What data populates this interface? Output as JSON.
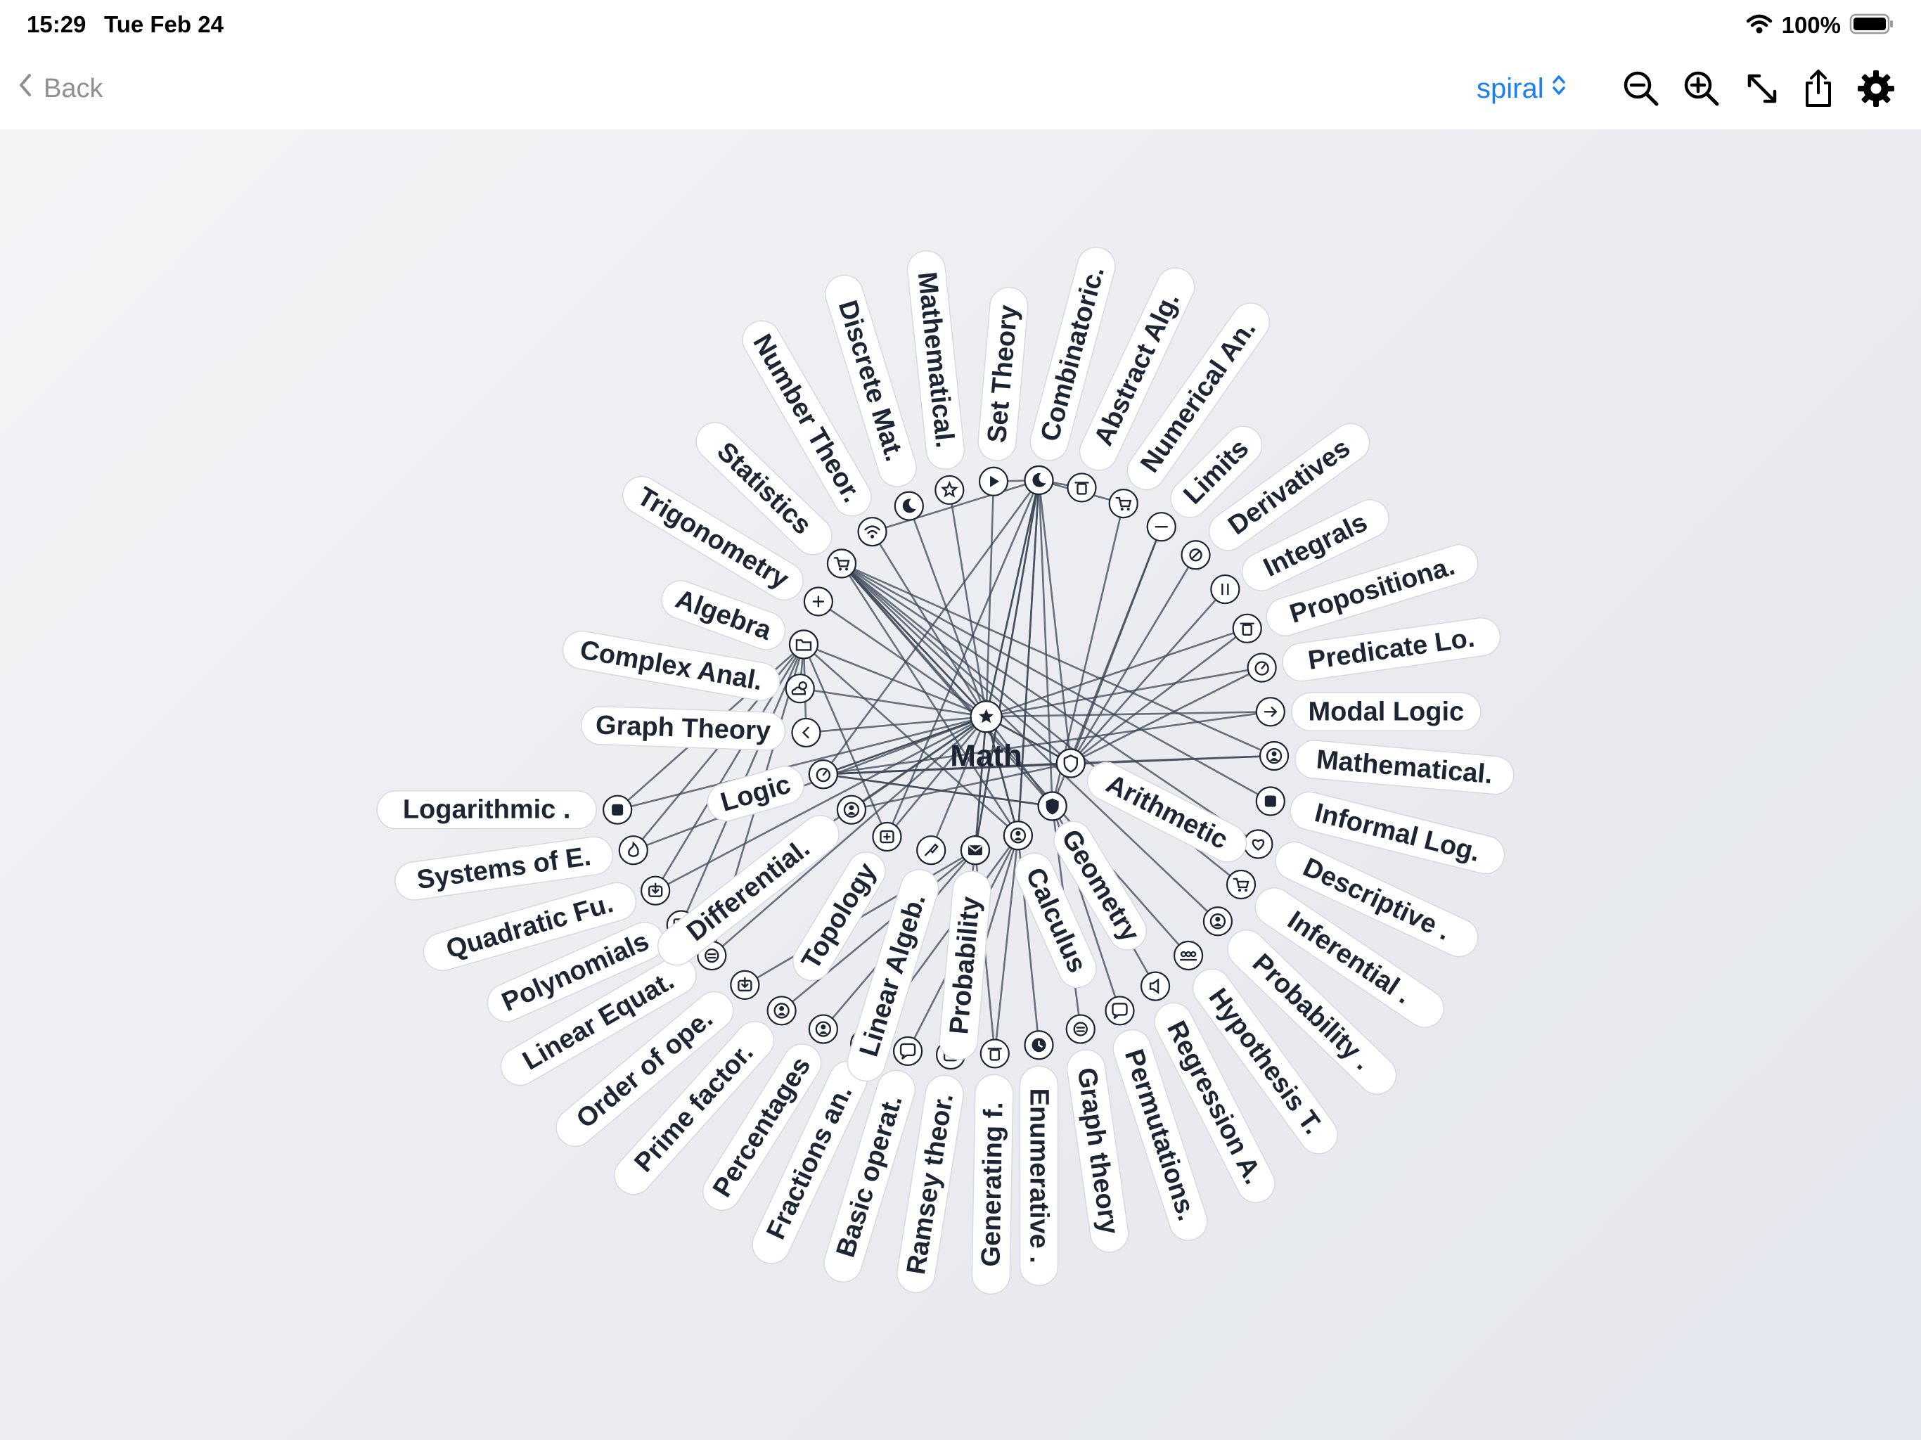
{
  "status_bar": {
    "time": "15:29",
    "date": "Tue Feb 24",
    "battery": "100%"
  },
  "toolbar": {
    "back_label": "Back",
    "layout_mode": "spiral",
    "icons": [
      "zoom-out-icon",
      "zoom-in-icon",
      "expand-icon",
      "share-icon",
      "gear-icon"
    ],
    "accent_color": "#1a7ff0"
  },
  "graph": {
    "root": {
      "label": "Math",
      "icon": "star"
    },
    "hubs": {
      "star": {
        "icon": "star"
      },
      "shield": {
        "icon": "shield-outline"
      },
      "shield2": {
        "icon": "shield-filled"
      },
      "moon": {
        "icon": "moon"
      },
      "cart": {
        "icon": "cart"
      },
      "timer": {
        "icon": "timer"
      },
      "person": {
        "icon": "person"
      },
      "mail": {
        "icon": "mail"
      },
      "folder": {
        "icon": "folder"
      }
    },
    "nodes": [
      {
        "label": "Number Theor.",
        "icon": "wifi"
      },
      {
        "label": "Discrete Mat.",
        "icon": "moon"
      },
      {
        "label": "Mathematical.",
        "icon": "star-outline"
      },
      {
        "label": "Set Theory",
        "icon": "play"
      },
      {
        "label": "Combinatoric.",
        "icon": "moon"
      },
      {
        "label": "Abstract Alg.",
        "icon": "trash"
      },
      {
        "label": "Numerical An.",
        "icon": "cart"
      },
      {
        "label": "Limits",
        "icon": "minus"
      },
      {
        "label": "Derivatives",
        "icon": "slash"
      },
      {
        "label": "Integrals",
        "icon": "pause"
      },
      {
        "label": "Propositiona.",
        "icon": "trash"
      },
      {
        "label": "Predicate Lo.",
        "icon": "timer"
      },
      {
        "label": "Modal Logic",
        "icon": "arrow-right"
      },
      {
        "label": "Mathematical.",
        "icon": "person"
      },
      {
        "label": "Informal Log.",
        "icon": "stop"
      },
      {
        "label": "Descriptive .",
        "icon": "heart"
      },
      {
        "label": "Inferential .",
        "icon": "cart"
      },
      {
        "label": "Probability .",
        "icon": "person"
      },
      {
        "label": "Hypothesis T.",
        "icon": "group"
      },
      {
        "label": "Regression A.",
        "icon": "speaker"
      },
      {
        "label": "Permutations.",
        "icon": "bubble"
      },
      {
        "label": "Graph theory",
        "icon": "disc"
      },
      {
        "label": "Enumerative .",
        "icon": "clock"
      },
      {
        "label": "Generating f.",
        "icon": "trash"
      },
      {
        "label": "Ramsey theor.",
        "icon": "minus-box"
      },
      {
        "label": "Basic operat.",
        "icon": "bubble"
      },
      {
        "label": "Fractions an.",
        "icon": "cloud"
      },
      {
        "label": "Percentages",
        "icon": "person"
      },
      {
        "label": "Prime factor.",
        "icon": "person"
      },
      {
        "label": "Order of ope.",
        "icon": "download"
      },
      {
        "label": "Linear Equat.",
        "icon": "disc"
      },
      {
        "label": "Polynomials",
        "icon": "monitor"
      },
      {
        "label": "Quadratic Fu.",
        "icon": "download"
      },
      {
        "label": "Systems of E.",
        "icon": "flame"
      },
      {
        "label": "Logarithmic .",
        "icon": "stop"
      },
      {
        "label": "Graph Theory",
        "icon": "chevron-left"
      },
      {
        "label": "Complex Anal.",
        "icon": "cloud-sun"
      },
      {
        "label": "Algebra",
        "icon": "folder"
      },
      {
        "label": "Trigonometry",
        "icon": "plus"
      },
      {
        "label": "Statistics",
        "icon": "cart"
      },
      {
        "label": "Logic",
        "icon": "timer"
      },
      {
        "label": "Differential.",
        "icon": "person"
      },
      {
        "label": "Topology",
        "icon": "plus-box"
      },
      {
        "label": "Linear Algeb.",
        "icon": "pin"
      },
      {
        "label": "Probability",
        "icon": "mail"
      },
      {
        "label": "Calculus",
        "icon": "person"
      },
      {
        "label": "Geometry",
        "icon": "shield"
      },
      {
        "label": "Arithmetic",
        "icon": "shield-outline"
      }
    ]
  }
}
